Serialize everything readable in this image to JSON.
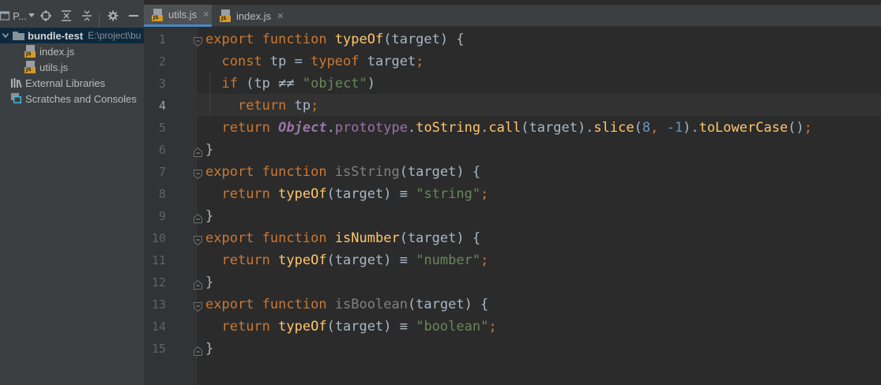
{
  "sidebar": {
    "project_selector_label": "P...",
    "tree": [
      {
        "kind": "root",
        "name": "bundle-test",
        "path": "E:\\project\\bu"
      },
      {
        "kind": "file",
        "name": "index.js",
        "icon": "js-file-icon"
      },
      {
        "kind": "file",
        "name": "utils.js",
        "icon": "js-file-icon"
      },
      {
        "kind": "libs",
        "name": "External Libraries",
        "icon": "library-icon"
      },
      {
        "kind": "scratch",
        "name": "Scratches and Consoles",
        "icon": "scratches-icon"
      }
    ]
  },
  "tabs": [
    {
      "label": "utils.js",
      "active": true,
      "close": "✕",
      "icon": "js-file-icon"
    },
    {
      "label": "index.js",
      "active": false,
      "close": "✕",
      "icon": "js-file-icon"
    }
  ],
  "editor": {
    "current_line": 4,
    "lines": [
      {
        "num": "1",
        "tokens": [
          [
            "kw",
            "export"
          ],
          [
            "p",
            " "
          ],
          [
            "kw",
            "function"
          ],
          [
            "p",
            " "
          ],
          [
            "fn",
            "typeOf"
          ],
          [
            "p",
            "(target) {"
          ]
        ]
      },
      {
        "num": "2",
        "tokens": [
          [
            "p",
            "  "
          ],
          [
            "kw",
            "const"
          ],
          [
            "p",
            " tp = "
          ],
          [
            "kw",
            "typeof"
          ],
          [
            "p",
            " target"
          ],
          [
            "kw",
            ";"
          ]
        ]
      },
      {
        "num": "3",
        "tokens": [
          [
            "p",
            "  "
          ],
          [
            "kw",
            "if"
          ],
          [
            "p",
            " (tp "
          ],
          [
            "p",
            "≠≠"
          ],
          [
            "p",
            " "
          ],
          [
            "str",
            "\"object\""
          ],
          [
            "p",
            ")"
          ]
        ]
      },
      {
        "num": "4",
        "tokens": [
          [
            "p",
            "    "
          ],
          [
            "kw",
            "return"
          ],
          [
            "p",
            " tp"
          ],
          [
            "kw",
            ";"
          ]
        ]
      },
      {
        "num": "5",
        "tokens": [
          [
            "p",
            "  "
          ],
          [
            "kw",
            "return"
          ],
          [
            "p",
            " "
          ],
          [
            "ptype",
            "Object"
          ],
          [
            "p",
            "."
          ],
          [
            "prop",
            "prototype"
          ],
          [
            "p",
            "."
          ],
          [
            "fn",
            "toString"
          ],
          [
            "p",
            "."
          ],
          [
            "fn",
            "call"
          ],
          [
            "p",
            "(target)."
          ],
          [
            "fn",
            "slice"
          ],
          [
            "p",
            "("
          ],
          [
            "num",
            "8"
          ],
          [
            "kw",
            ","
          ],
          [
            "p",
            " "
          ],
          [
            "num",
            "-1"
          ],
          [
            "p",
            ")."
          ],
          [
            "fn",
            "toLowerCase"
          ],
          [
            "p",
            "()"
          ],
          [
            "kw",
            ";"
          ]
        ]
      },
      {
        "num": "6",
        "tokens": [
          [
            "p",
            "}"
          ]
        ]
      },
      {
        "num": "7",
        "tokens": [
          [
            "kw",
            "export"
          ],
          [
            "p",
            " "
          ],
          [
            "kw",
            "function"
          ],
          [
            "p",
            " "
          ],
          [
            "dim",
            "isString"
          ],
          [
            "p",
            "(target) {"
          ]
        ]
      },
      {
        "num": "8",
        "tokens": [
          [
            "p",
            "  "
          ],
          [
            "kw",
            "return"
          ],
          [
            "p",
            " "
          ],
          [
            "fn",
            "typeOf"
          ],
          [
            "p",
            "(target) "
          ],
          [
            "p",
            "≡"
          ],
          [
            "p",
            " "
          ],
          [
            "str",
            "\"string\""
          ],
          [
            "kw",
            ";"
          ]
        ]
      },
      {
        "num": "9",
        "tokens": [
          [
            "p",
            "}"
          ]
        ]
      },
      {
        "num": "10",
        "tokens": [
          [
            "kw",
            "export"
          ],
          [
            "p",
            " "
          ],
          [
            "kw",
            "function"
          ],
          [
            "p",
            " "
          ],
          [
            "fn",
            "isNumber"
          ],
          [
            "p",
            "(target) {"
          ]
        ]
      },
      {
        "num": "11",
        "tokens": [
          [
            "p",
            "  "
          ],
          [
            "kw",
            "return"
          ],
          [
            "p",
            " "
          ],
          [
            "fn",
            "typeOf"
          ],
          [
            "p",
            "(target) "
          ],
          [
            "p",
            "≡"
          ],
          [
            "p",
            " "
          ],
          [
            "str",
            "\"number\""
          ],
          [
            "kw",
            ";"
          ]
        ]
      },
      {
        "num": "12",
        "tokens": [
          [
            "p",
            "}"
          ]
        ]
      },
      {
        "num": "13",
        "tokens": [
          [
            "kw",
            "export"
          ],
          [
            "p",
            " "
          ],
          [
            "kw",
            "function"
          ],
          [
            "p",
            " "
          ],
          [
            "dim",
            "isBoolean"
          ],
          [
            "p",
            "(target) {"
          ]
        ]
      },
      {
        "num": "14",
        "tokens": [
          [
            "p",
            "  "
          ],
          [
            "kw",
            "return"
          ],
          [
            "p",
            " "
          ],
          [
            "fn",
            "typeOf"
          ],
          [
            "p",
            "(target) "
          ],
          [
            "p",
            "≡"
          ],
          [
            "p",
            " "
          ],
          [
            "str",
            "\"boolean\""
          ],
          [
            "kw",
            ";"
          ]
        ]
      },
      {
        "num": "15",
        "tokens": [
          [
            "p",
            "}"
          ]
        ]
      }
    ]
  },
  "colors": {
    "keyword": "#cc7832",
    "function": "#ffc66d",
    "string": "#6a8759",
    "number": "#6897bb",
    "plain": "#a9b7c6",
    "gutter_number": "#606366",
    "editor_bg": "#2b2b2b",
    "sidebar_bg": "#3c3f41",
    "active_tab_underline": "#4a88c7"
  }
}
